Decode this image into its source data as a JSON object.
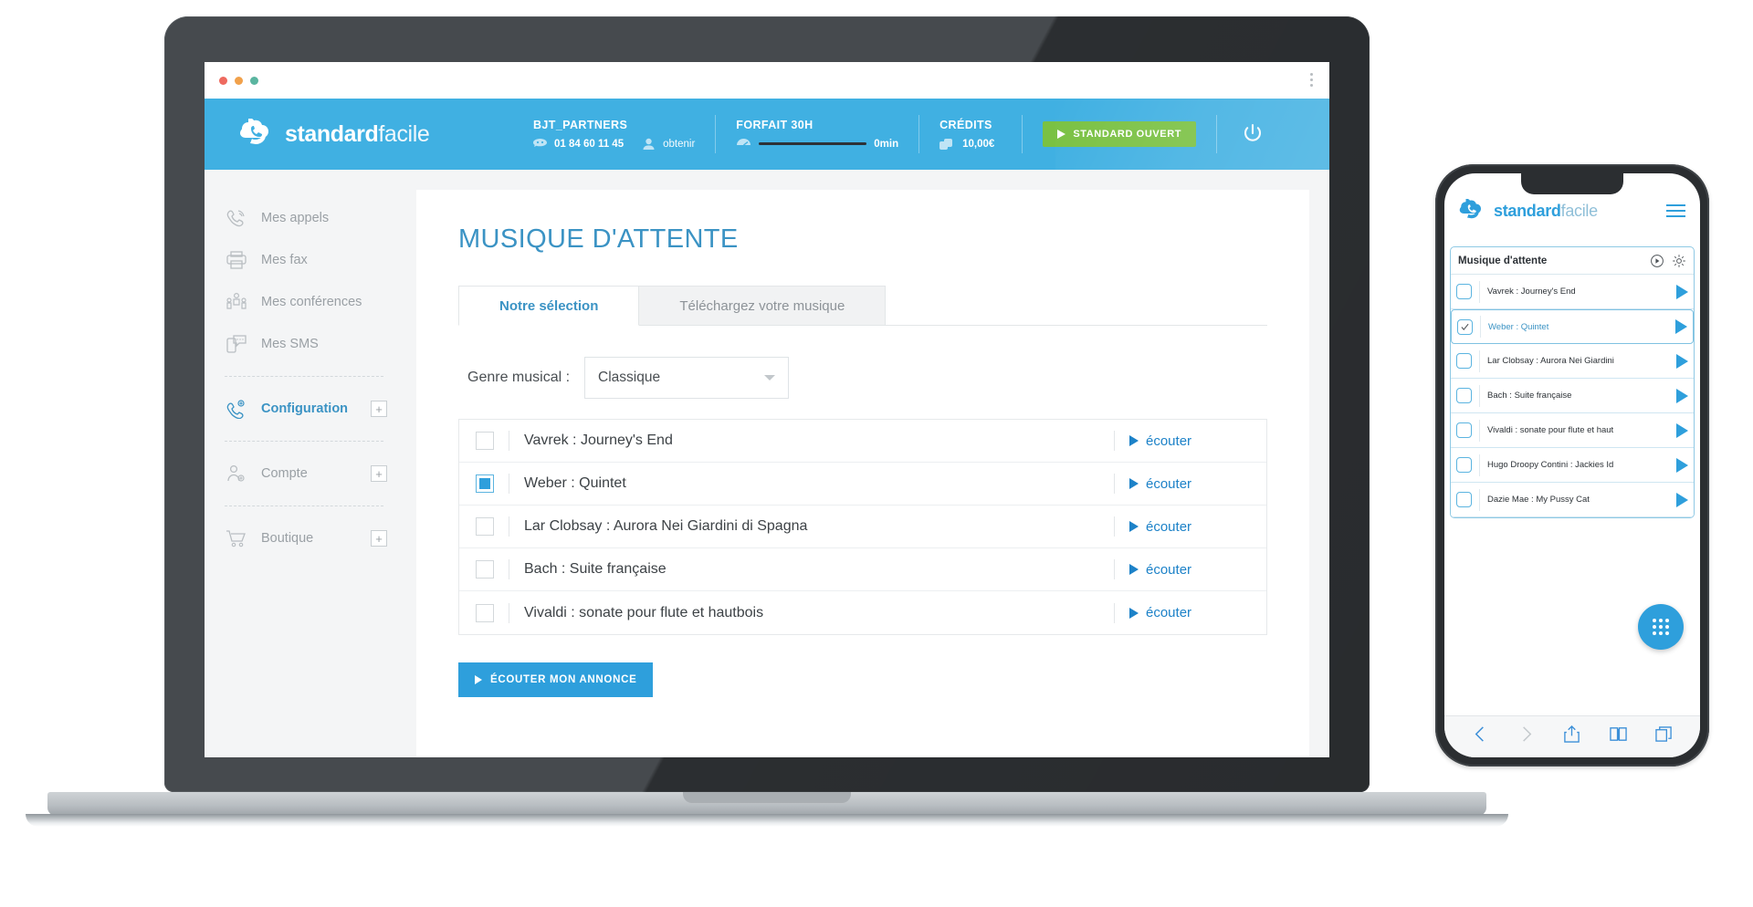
{
  "brand": {
    "name_bold": "standard",
    "name_light": "facile",
    "accent": "#2e9fdc",
    "header_bg": "#40b0e2",
    "green": "#7ac143"
  },
  "browser": {
    "dots": [
      "close",
      "minimize",
      "zoom"
    ],
    "menu_icon": "kebab-menu-icon"
  },
  "header": {
    "account": {
      "title": "BJT_PARTNERS",
      "phone": "01 84 60 11 45",
      "obtain_label": "obtenir"
    },
    "plan": {
      "title": "FORFAIT 30H",
      "usage": "0min"
    },
    "credits": {
      "title": "CRÉDITS",
      "amount": "10,00€"
    },
    "status_button": "STANDARD OUVERT",
    "power_icon": "power-icon"
  },
  "sidebar": {
    "items": [
      {
        "label": "Mes appels",
        "icon": "phone-ring-icon",
        "active": false,
        "expandable": false
      },
      {
        "label": "Mes fax",
        "icon": "printer-icon",
        "active": false,
        "expandable": false
      },
      {
        "label": "Mes conférences",
        "icon": "conference-people-icon",
        "active": false,
        "expandable": false
      },
      {
        "label": "Mes SMS",
        "icon": "sms-bubble-icon",
        "active": false,
        "expandable": false
      },
      {
        "label": "Configuration",
        "icon": "phone-gear-icon",
        "active": true,
        "expandable": true
      },
      {
        "label": "Compte",
        "icon": "user-gear-icon",
        "active": false,
        "expandable": true
      },
      {
        "label": "Boutique",
        "icon": "shopping-cart-icon",
        "active": false,
        "expandable": true
      }
    ],
    "expand_symbol": "+"
  },
  "main": {
    "page_title": "MUSIQUE D'ATTENTE",
    "tabs": [
      {
        "label": "Notre sélection",
        "active": true
      },
      {
        "label": "Téléchargez votre musique",
        "active": false
      }
    ],
    "genre": {
      "label": "Genre musical :",
      "value": "Classique"
    },
    "tracks": [
      {
        "name": "Vavrek : Journey's End",
        "checked": false,
        "listen": "écouter"
      },
      {
        "name": "Weber : Quintet",
        "checked": true,
        "listen": "écouter"
      },
      {
        "name": "Lar Clobsay : Aurora Nei Giardini di Spagna",
        "checked": false,
        "listen": "écouter"
      },
      {
        "name": "Bach : Suite française",
        "checked": false,
        "listen": "écouter"
      },
      {
        "name": "Vivaldi : sonate pour flute et hautbois",
        "checked": false,
        "listen": "écouter"
      }
    ],
    "announce_button": "ÉCOUTER MON ANNONCE"
  },
  "mobile": {
    "menu_icon": "hamburger-menu-icon",
    "panel_title": "Musique d'attente",
    "panel_icons": [
      "play-circle-icon",
      "gear-icon"
    ],
    "tracks": [
      {
        "name": "Vavrek : Journey's End",
        "checked": false
      },
      {
        "name": "Weber : Quintet",
        "checked": true
      },
      {
        "name": "Lar Clobsay : Aurora Nei Giardini",
        "checked": false
      },
      {
        "name": "Bach : Suite française",
        "checked": false
      },
      {
        "name": "Vivaldi : sonate pour flute et haut",
        "checked": false
      },
      {
        "name": "Hugo Droopy Contini : Jackies Id",
        "checked": false
      },
      {
        "name": "Dazie Mae : My Pussy Cat",
        "checked": false
      }
    ],
    "fab_icon": "dialpad-icon",
    "bottom_bar": [
      "back-icon",
      "forward-icon",
      "share-icon",
      "bookmarks-icon",
      "tabs-icon"
    ]
  }
}
